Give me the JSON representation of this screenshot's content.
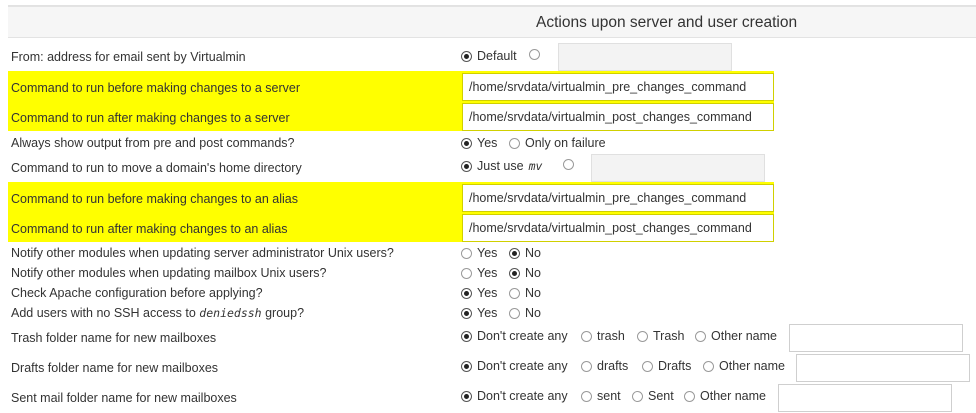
{
  "section": {
    "title": "Actions upon server and user creation"
  },
  "rows": {
    "from_address": {
      "label": "From: address for email sent by Virtualmin",
      "opt_default": "Default",
      "value": ""
    },
    "pre_server": {
      "label": "Command to run before making changes to a server",
      "value": "/home/srvdata/virtualmin_pre_changes_command"
    },
    "post_server": {
      "label": "Command to run after making changes to a server",
      "value": "/home/srvdata/virtualmin_post_changes_command"
    },
    "show_output": {
      "label": "Always show output from pre and post commands?",
      "opt_yes": "Yes",
      "opt_failure": "Only on failure"
    },
    "move_home": {
      "label_pre": "Command to run to move a domain's home directory",
      "opt_just": "Just use",
      "opt_mv": "mv",
      "value": ""
    },
    "pre_alias": {
      "label": "Command to run before making changes to an alias",
      "value": "/home/srvdata/virtualmin_pre_changes_command"
    },
    "post_alias": {
      "label": "Command to run after making changes to an alias",
      "value": "/home/srvdata/virtualmin_post_changes_command"
    },
    "notify_admin": {
      "label": "Notify other modules when updating server administrator Unix users?",
      "opt_yes": "Yes",
      "opt_no": "No"
    },
    "notify_mailbox": {
      "label": "Notify other modules when updating mailbox Unix users?",
      "opt_yes": "Yes",
      "opt_no": "No"
    },
    "check_apache": {
      "label": "Check Apache configuration before applying?",
      "opt_yes": "Yes",
      "opt_no": "No"
    },
    "deniedssh": {
      "label_pre": "Add users with no SSH access to",
      "label_code": "deniedssh",
      "label_post": "group?",
      "opt_yes": "Yes",
      "opt_no": "No"
    },
    "trash": {
      "label": "Trash folder name for new mailboxes",
      "opt_none": "Don't create any",
      "opt_lower": "trash",
      "opt_upper": "Trash",
      "opt_other": "Other name",
      "value": ""
    },
    "drafts": {
      "label": "Drafts folder name for new mailboxes",
      "opt_none": "Don't create any",
      "opt_lower": "drafts",
      "opt_upper": "Drafts",
      "opt_other": "Other name",
      "value": ""
    },
    "sent": {
      "label": "Sent mail folder name for new mailboxes",
      "opt_none": "Don't create any",
      "opt_lower": "sent",
      "opt_upper": "Sent",
      "opt_other": "Other name",
      "value": ""
    }
  },
  "colors": {
    "highlight": "#ffff00",
    "header_bg": "#f6f6f6"
  }
}
